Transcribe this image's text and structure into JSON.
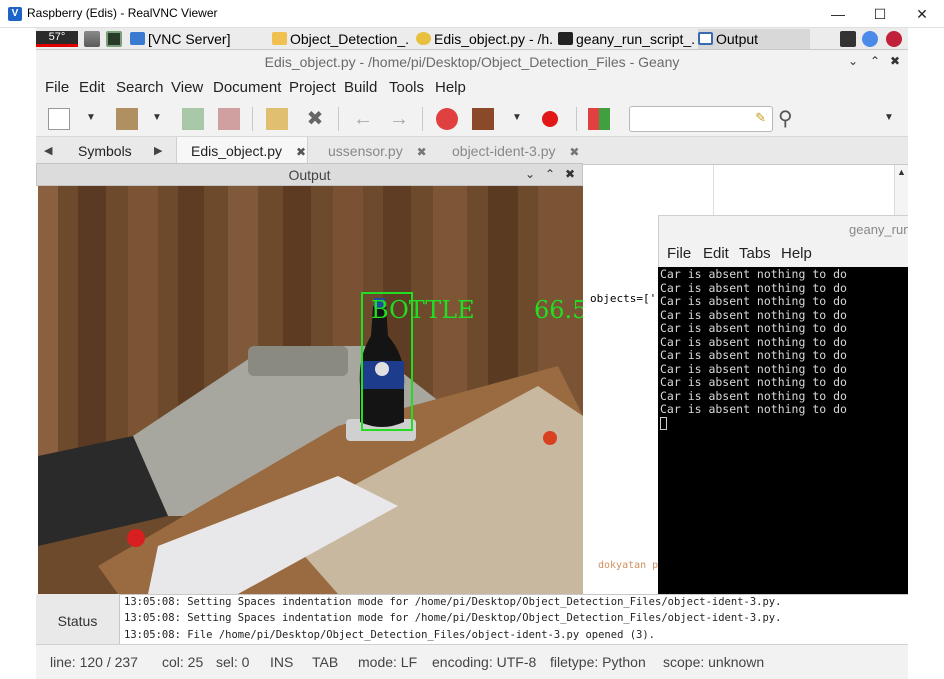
{
  "window": {
    "title": "Raspberry (Edis) - RealVNC Viewer",
    "app_icon": "V"
  },
  "taskbar": {
    "temperature": "57°",
    "tasks": [
      {
        "label": "[VNC Server]",
        "icon": "vnc-icon"
      },
      {
        "label": "Object_Detection_...",
        "icon": "folder-icon"
      },
      {
        "label": "Edis_object.py - /h...",
        "icon": "geany-icon"
      },
      {
        "label": "geany_run_script_...",
        "icon": "terminal-icon"
      },
      {
        "label": "Output",
        "icon": "window-icon"
      }
    ]
  },
  "geany": {
    "title": "Edis_object.py - /home/pi/Desktop/Object_Detection_Files - Geany",
    "menu": [
      "File",
      "Edit",
      "Search",
      "View",
      "Document",
      "Project",
      "Build",
      "Tools",
      "Help"
    ],
    "sidebar_tab": "Symbols",
    "tabs": [
      {
        "label": "Edis_object.py",
        "close": "✖"
      },
      {
        "label": "ussensor.py",
        "close": "✖"
      },
      {
        "label": "object-ident-3.py",
        "close": "✖"
      }
    ],
    "editor_snippet": "objects=['",
    "editor_snippet2": "dokyatan pr"
  },
  "output_window": {
    "title": "Output",
    "detection": {
      "label": "BOTTLE",
      "confidence": "66.5"
    }
  },
  "terminal": {
    "title": "geany_run",
    "menu": [
      "File",
      "Edit",
      "Tabs",
      "Help"
    ],
    "lines": [
      "Car is absent nothing to do",
      "Car is absent nothing to do",
      "Car is absent nothing to do",
      "Car is absent nothing to do",
      "Car is absent nothing to do",
      "Car is absent nothing to do",
      "Car is absent nothing to do",
      "Car is absent nothing to do",
      "Car is absent nothing to do",
      "Car is absent nothing to do",
      "Car is absent nothing to do"
    ]
  },
  "messages": {
    "tab_label": "Status",
    "lines": [
      "13:05:08: Setting Spaces indentation mode for /home/pi/Desktop/Object_Detection_Files/object-ident-3.py.",
      "13:05:08: Setting Spaces indentation mode for /home/pi/Desktop/Object_Detection_Files/object-ident-3.py.",
      "13:05:08: File /home/pi/Desktop/Object_Detection_Files/object-ident-3.py opened (3)."
    ]
  },
  "statusbar": {
    "line": "line: 120 / 237",
    "col": "col: 25",
    "sel": "sel: 0",
    "ins": "INS",
    "tab": "TAB",
    "mode": "mode: LF",
    "encoding": "encoding: UTF-8",
    "filetype": "filetype: Python",
    "scope": "scope: unknown"
  },
  "colors": {
    "detection_box": "#22dd22",
    "terminal_bg": "#000000",
    "temp_bar": "#e00000"
  }
}
